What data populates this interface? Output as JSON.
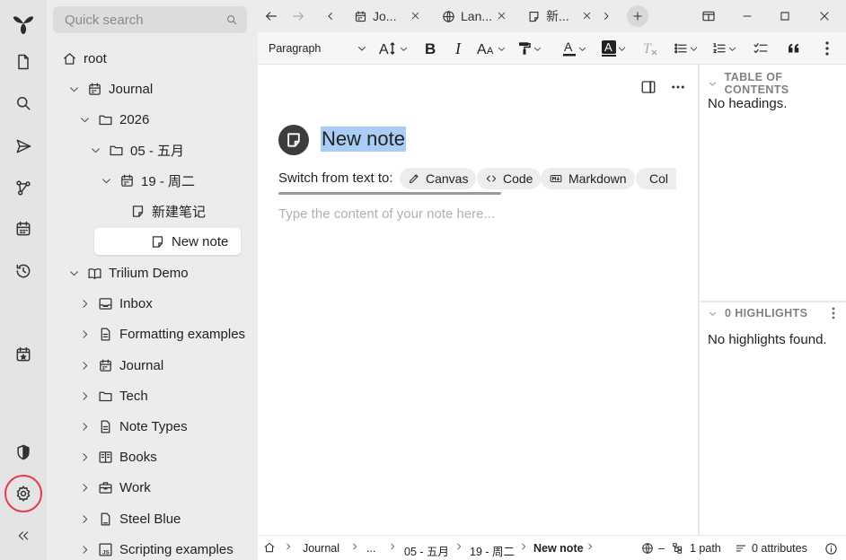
{
  "launcher": {
    "items": [
      {
        "name": "app-logo",
        "icon": "trilium-leaf-logo"
      },
      {
        "name": "new-note-button",
        "icon": "file-icon"
      },
      {
        "name": "search-button",
        "icon": "search-icon"
      },
      {
        "name": "jump-to-button",
        "icon": "send-icon"
      },
      {
        "name": "note-map-button",
        "icon": "graph-icon"
      },
      {
        "name": "calendar-button",
        "icon": "calendar-icon"
      },
      {
        "name": "recent-changes-button",
        "icon": "history-icon"
      },
      {
        "name": "today-button",
        "icon": "calendar-star-icon"
      },
      {
        "name": "protected-session-button",
        "icon": "shield-icon"
      },
      {
        "name": "settings-button",
        "icon": "gear-icon"
      },
      {
        "name": "collapse-launcher-button",
        "icon": "double-chevron-left-icon"
      }
    ],
    "highlight_color": "#e33b4a"
  },
  "tree": {
    "search_placeholder": "Quick search",
    "rows": [
      {
        "label": "root",
        "icon": "home-icon",
        "chevron": "none",
        "level": 0
      },
      {
        "label": "Journal",
        "icon": "calendar-icon",
        "chevron": "down",
        "level": 1
      },
      {
        "label": "2026",
        "icon": "folder-icon",
        "chevron": "down",
        "level": 2
      },
      {
        "label": "05 - 五月",
        "icon": "folder-icon",
        "chevron": "down",
        "level": 3
      },
      {
        "label": "19 - 周二",
        "icon": "calendar-icon",
        "chevron": "down",
        "level": 4
      },
      {
        "label": "新建笔记",
        "icon": "note-icon",
        "chevron": "none",
        "level": 5
      },
      {
        "label": "New note",
        "icon": "note-icon",
        "chevron": "none",
        "level": 5,
        "active": true
      },
      {
        "label": "Trilium Demo",
        "icon": "book-open-icon",
        "chevron": "down",
        "level": 1
      },
      {
        "label": "Inbox",
        "icon": "inbox-icon",
        "chevron": "right",
        "level": 2
      },
      {
        "label": "Formatting examples",
        "icon": "text-file-icon",
        "chevron": "right",
        "level": 2
      },
      {
        "label": "Journal",
        "icon": "calendar-icon",
        "chevron": "right",
        "level": 2
      },
      {
        "label": "Tech",
        "icon": "folder-icon",
        "chevron": "right",
        "level": 2
      },
      {
        "label": "Note Types",
        "icon": "text-file-icon",
        "chevron": "right",
        "level": 2
      },
      {
        "label": "Books",
        "icon": "book-icon",
        "chevron": "right",
        "level": 2
      },
      {
        "label": "Work",
        "icon": "briefcase-icon",
        "chevron": "right",
        "level": 2
      },
      {
        "label": "Steel Blue",
        "icon": "css-file-icon",
        "chevron": "right",
        "level": 2
      },
      {
        "label": "Scripting examples",
        "icon": "js-file-icon",
        "chevron": "right",
        "level": 2
      }
    ]
  },
  "tabs": [
    {
      "title": "Jo...",
      "icon": "calendar-icon"
    },
    {
      "title": "Lan...",
      "icon": "globe-icon"
    },
    {
      "title": "新...",
      "icon": "note-icon"
    }
  ],
  "toolbar": {
    "paragraph_label": "Paragraph"
  },
  "note": {
    "title": "New note",
    "switch_label": "Switch from text to:",
    "switch_options": [
      {
        "label": "Canvas",
        "icon": "pen-icon"
      },
      {
        "label": "Code",
        "icon": "code-icon"
      },
      {
        "label": "Markdown",
        "icon": "markdown-icon"
      },
      {
        "label": "Col",
        "icon": "collection-icon"
      }
    ],
    "content_placeholder": "Type the content of your note here...",
    "title_highlight_color": "#a9cdf5"
  },
  "right_pane": {
    "toc_title": "TABLE OF CONTENTS",
    "toc_empty": "No headings.",
    "highlights_title": "0 HIGHLIGHTS",
    "highlights_empty": "No highlights found."
  },
  "statusbar": {
    "breadcrumbs": [
      "Journal",
      "...",
      "05 - 五月",
      "19 - 周二",
      "New note"
    ],
    "language": "–",
    "paths": "1 path",
    "attributes": "0 attributes"
  }
}
